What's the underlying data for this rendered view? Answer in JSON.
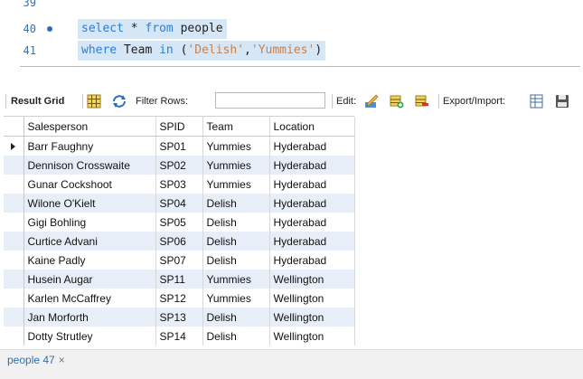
{
  "editor": {
    "lines": [
      {
        "number": "39"
      },
      {
        "number": "40",
        "kw1": "select",
        "rest1": " * ",
        "kw2": "from",
        "rest2": " people"
      },
      {
        "number": "41",
        "kw1": "where",
        "rest1": " Team ",
        "kw2": "in",
        "rest2": " (",
        "str1": "'Delish'",
        "comma": ",",
        "str2": "'Yummies'",
        "close": ")"
      }
    ]
  },
  "toolbar": {
    "result_grid_label": "Result Grid",
    "filter_rows_label": "Filter Rows:",
    "filter_rows_value": "",
    "edit_label": "Edit:",
    "export_import_label": "Export/Import:"
  },
  "grid": {
    "columns": [
      "Salesperson",
      "SPID",
      "Team",
      "Location"
    ],
    "rows": [
      [
        "Barr Faughny",
        "SP01",
        "Yummies",
        "Hyderabad"
      ],
      [
        "Dennison Crosswaite",
        "SP02",
        "Yummies",
        "Hyderabad"
      ],
      [
        "Gunar Cockshoot",
        "SP03",
        "Yummies",
        "Hyderabad"
      ],
      [
        "Wilone O'Kielt",
        "SP04",
        "Delish",
        "Hyderabad"
      ],
      [
        "Gigi Bohling",
        "SP05",
        "Delish",
        "Hyderabad"
      ],
      [
        "Curtice Advani",
        "SP06",
        "Delish",
        "Hyderabad"
      ],
      [
        "Kaine Padly",
        "SP07",
        "Delish",
        "Hyderabad"
      ],
      [
        "Husein Augar",
        "SP11",
        "Yummies",
        "Wellington"
      ],
      [
        "Karlen McCaffrey",
        "SP12",
        "Yummies",
        "Wellington"
      ],
      [
        "Jan Morforth",
        "SP13",
        "Delish",
        "Wellington"
      ],
      [
        "Dotty Strutley",
        "SP14",
        "Delish",
        "Wellington"
      ]
    ]
  },
  "tabs": [
    {
      "label": "people 47",
      "close": "×"
    }
  ],
  "colors": {
    "keyword": "#2e7fd6",
    "string": "#c9814a",
    "selection": "#d5e6f7",
    "alt_row": "#e7eef8",
    "tab_text": "#2f6fb4"
  }
}
